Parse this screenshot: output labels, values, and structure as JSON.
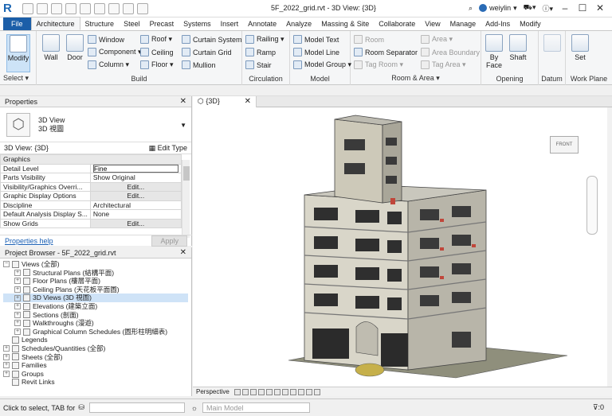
{
  "app": {
    "title": "5F_2022_grid.rvt - 3D View: {3D}",
    "user": "weiylin",
    "logo": "R"
  },
  "tabs": [
    "File",
    "Architecture",
    "Structure",
    "Steel",
    "Precast",
    "Systems",
    "Insert",
    "Annotate",
    "Analyze",
    "Massing & Site",
    "Collaborate",
    "View",
    "Manage",
    "Add-Ins",
    "Modify"
  ],
  "ribbon": {
    "select": {
      "label": "Select ▾",
      "modify": "Modify"
    },
    "build": {
      "label": "Build",
      "wall": "Wall",
      "door": "Door",
      "window": "Window",
      "component": "Component ▾",
      "column": "Column ▾",
      "roof": "Roof ▾",
      "ceiling": "Ceiling",
      "floor": "Floor ▾",
      "curtain_system": "Curtain System",
      "curtain_grid": "Curtain Grid",
      "mullion": "Mullion"
    },
    "circulation": {
      "label": "Circulation",
      "railing": "Railing ▾",
      "ramp": "Ramp",
      "stair": "Stair"
    },
    "model": {
      "label": "Model",
      "text": "Model Text",
      "line": "Model Line",
      "group": "Model Group ▾"
    },
    "room": {
      "label": "Room & Area ▾",
      "room": "Room",
      "separator": "Room Separator",
      "tag_room": "Tag Room ▾",
      "area": "Area ▾",
      "area_boundary": "Area Boundary",
      "tag_area": "Tag Area ▾"
    },
    "opening": {
      "label": "Opening",
      "by_face": "By Face",
      "shaft": "Shaft"
    },
    "datum": {
      "label": "Datum"
    },
    "work_plane": {
      "label": "Work Plane",
      "set": "Set"
    }
  },
  "properties": {
    "header": "Properties",
    "type_name": "3D View",
    "type_name_cn": "3D 視圖",
    "view_label": "3D View: {3D}",
    "edit_type": "Edit Type",
    "rows": [
      {
        "name": "Graphics",
        "value": "",
        "group": true
      },
      {
        "name": "Detail Level",
        "value": "Fine",
        "input": true
      },
      {
        "name": "Parts Visibility",
        "value": "Show Original"
      },
      {
        "name": "Visibility/Graphics Overri...",
        "value": "Edit...",
        "button": true
      },
      {
        "name": "Graphic Display Options",
        "value": "Edit...",
        "button": true
      },
      {
        "name": "Discipline",
        "value": "Architectural"
      },
      {
        "name": "Default Analysis Display S...",
        "value": "None"
      },
      {
        "name": "Show Grids",
        "value": "Edit...",
        "button": true
      }
    ],
    "help": "Properties help",
    "apply": "Apply"
  },
  "browser": {
    "header": "Project Browser - 5F_2022_grid.rvt",
    "items": [
      {
        "label": "Views (全部)",
        "level": 0,
        "toggle": "−"
      },
      {
        "label": "Structural Plans (結構平面)",
        "level": 1,
        "toggle": "+"
      },
      {
        "label": "Floor Plans (樓層平面)",
        "level": 1,
        "toggle": "+"
      },
      {
        "label": "Ceiling Plans (天花板平面圖)",
        "level": 1,
        "toggle": "+"
      },
      {
        "label": "3D Views (3D 視圖)",
        "level": 1,
        "toggle": "+",
        "selected": true
      },
      {
        "label": "Elevations (建築立面)",
        "level": 1,
        "toggle": "+"
      },
      {
        "label": "Sections (剖面)",
        "level": 1,
        "toggle": "+"
      },
      {
        "label": "Walkthroughs (漫遊)",
        "level": 1,
        "toggle": "+"
      },
      {
        "label": "Graphical Column Schedules (圖形柱明細表)",
        "level": 1,
        "toggle": "+"
      },
      {
        "label": "Legends",
        "level": 0,
        "toggle": ""
      },
      {
        "label": "Schedules/Quantities (全部)",
        "level": 0,
        "toggle": "+"
      },
      {
        "label": "Sheets (全部)",
        "level": 0,
        "toggle": "+"
      },
      {
        "label": "Families",
        "level": 0,
        "toggle": "+"
      },
      {
        "label": "Groups",
        "level": 0,
        "toggle": "+"
      },
      {
        "label": "Revit Links",
        "level": 0,
        "toggle": ""
      }
    ]
  },
  "viewport": {
    "tab_label": "{3D}",
    "viewcube": "FRONT",
    "view_bar_label": "Perspective"
  },
  "status": {
    "hint": "Click to select, TAB for",
    "model": "Main Model",
    "filter": ":0"
  }
}
